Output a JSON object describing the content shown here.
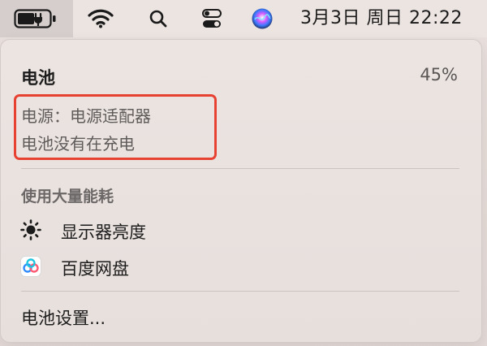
{
  "menubar": {
    "clock": "3月3日 周日  22:22",
    "icons": [
      "battery-charging-icon",
      "wifi-icon",
      "search-icon",
      "control-center-icon",
      "siri-icon"
    ]
  },
  "battery_menu": {
    "title": "电池",
    "percent": "45%",
    "power_source": "电源：电源适配器",
    "charging_status": "电池没有在充电",
    "section_title": "使用大量能耗",
    "apps": [
      {
        "label": "显示器亮度",
        "icon": "sun-icon"
      },
      {
        "label": "百度网盘",
        "icon": "baidu-netdisk-icon"
      }
    ],
    "settings_label": "电池设置..."
  },
  "colors": {
    "highlight_border": "#e74132",
    "panel_bg": "#ece4e1"
  }
}
